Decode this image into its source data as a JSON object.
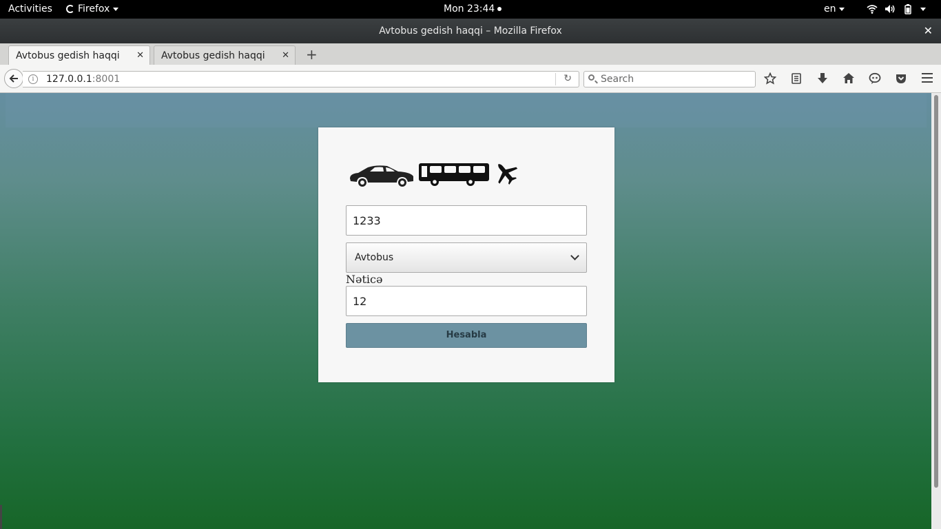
{
  "topbar": {
    "activities": "Activities",
    "app_name": "Firefox",
    "clock": "Mon 23:44",
    "language": "en"
  },
  "window": {
    "title": "Avtobus gedish haqqi – Mozilla Firefox",
    "close": "✕"
  },
  "tabs": [
    {
      "label": "Avtobus gedish haqqi",
      "active": true
    },
    {
      "label": "Avtobus gedish haqqi",
      "active": false
    }
  ],
  "new_tab": "+",
  "navbar": {
    "url_host": "127.0.0.1",
    "url_port": ":8001",
    "search_placeholder": "Search",
    "icons": [
      "bookmark-star-icon",
      "reading-list-icon",
      "downloads-icon",
      "home-icon",
      "chat-icon",
      "pocket-icon"
    ]
  },
  "form": {
    "amount_value": "1233",
    "transport_selected": "Avtobus",
    "result_label": "Nəticə",
    "result_value": "12",
    "submit_label": "Hesabla",
    "logos": [
      "car-icon",
      "bus-icon",
      "airplane-icon"
    ]
  },
  "colors": {
    "button": "#6c92a2",
    "gradient_top": "#658ea1",
    "gradient_bottom": "#176628"
  }
}
